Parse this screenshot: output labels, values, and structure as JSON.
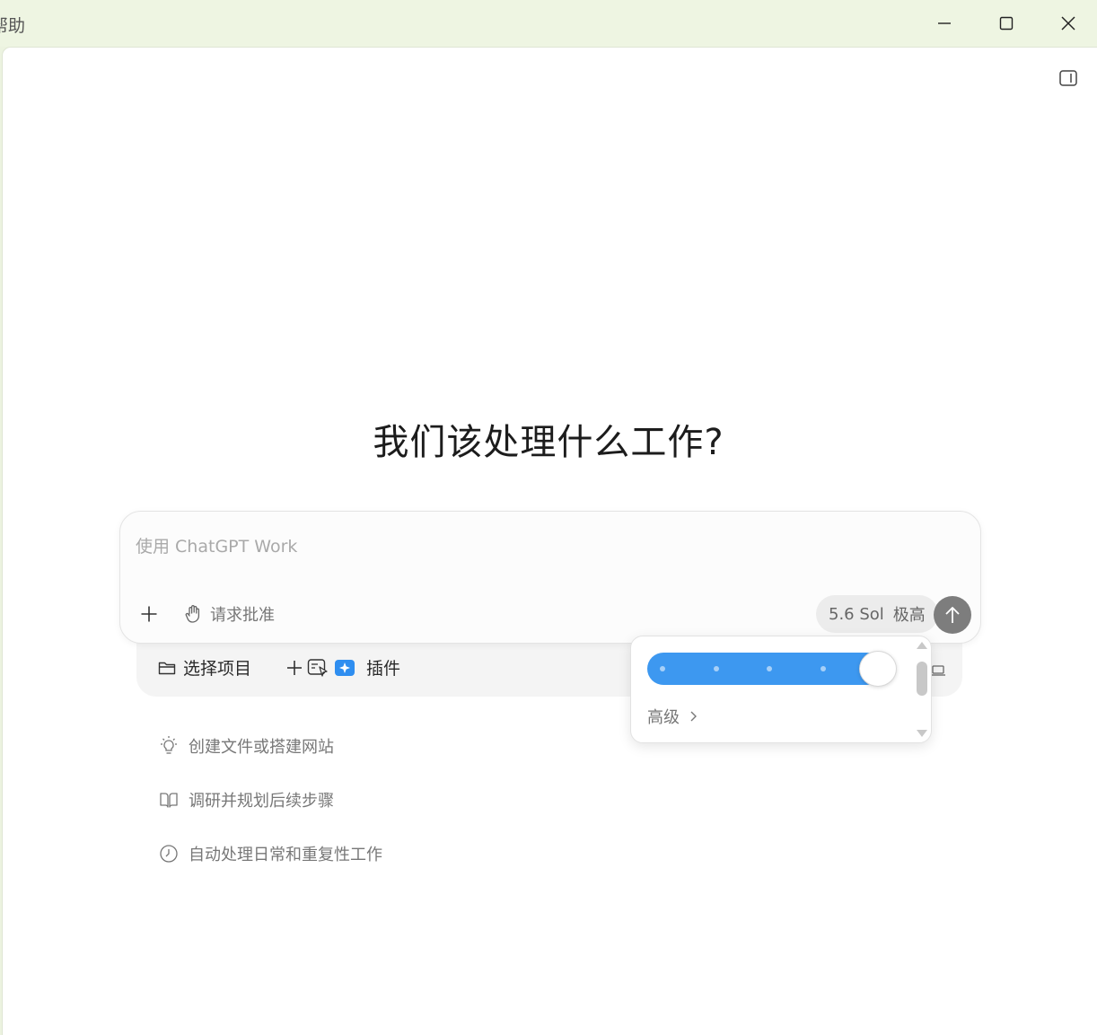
{
  "titlebar": {
    "menu_text": "帮助",
    "minimize_label": "minimize",
    "maximize_label": "maximize",
    "close_label": "close"
  },
  "main": {
    "heading": "我们该处理什么工作?"
  },
  "composer": {
    "placeholder": "使用 ChatGPT Work",
    "approval_label": "请求批准",
    "model_name": "5.6 Sol",
    "reasoning_level": "极高"
  },
  "chips": {
    "project_label": "选择项目",
    "plugins_label": "插件"
  },
  "popup": {
    "slider_level_fraction": 1.0,
    "advanced_label": "高级"
  },
  "suggestions": [
    {
      "icon": "lightbulb-icon",
      "label": "创建文件或搭建网站"
    },
    {
      "icon": "book-icon",
      "label": "调研并规划后续步骤"
    },
    {
      "icon": "clock-icon",
      "label": "自动处理日常和重复性工作"
    }
  ],
  "colors": {
    "accent": "#3d98f0",
    "titlebar_bg": "#eef5e2",
    "send_button": "#7d7d7d"
  }
}
